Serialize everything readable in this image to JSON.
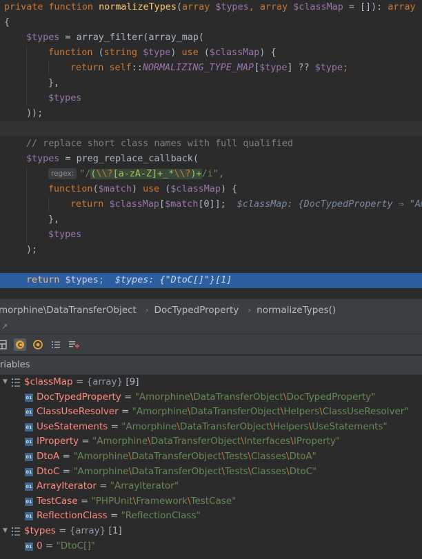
{
  "editor": {
    "signature": {
      "kw_private": "private",
      "kw_function": "function",
      "name": "normalizeTypes",
      "open": "(",
      "t1": "array",
      "p1": "$types",
      "c1": ",",
      "t2": "array",
      "p2": "$classMap",
      "def": " = []): ",
      "ret": "array"
    },
    "brace_open": "{",
    "l3_var": "$types",
    "l3_eq": " = ",
    "l3_fn": "array_filter(array_map(",
    "l4_function": "function",
    "l4_open": " (",
    "l4_string": "string",
    "l4_type": "$type",
    "l4_use_pre": ") ",
    "l4_use": "use",
    "l4_use_open": " (",
    "l4_classmap": "$classMap",
    "l4_close": ") {",
    "l5_return": "return",
    "l5_self": "self",
    "l5_dc": "::",
    "l5_const": "NORMALIZING_TYPE_MAP",
    "l5_br1": "[",
    "l5_type": "$type",
    "l5_br2": "] ?? ",
    "l5_type2": "$type",
    "l5_semi": ";",
    "l6_close": "},",
    "l7_types": "$types",
    "l8_close": "));",
    "l10_comment": "// replace short class names with full qualified",
    "l11_var": "$types",
    "l11_eq": " = ",
    "l11_fn": "preg_replace_callback(",
    "l12_hint": "regex:",
    "l12_q1": "\"/",
    "l12_re1": "(",
    "l12_re2": "\\\\?",
    "l12_re3": "[a-zA-Z]+_*",
    "l12_re4": "\\\\?",
    "l12_re5": ")+",
    "l12_q2": "/i\"",
    "l12_comma": ",",
    "l13_function": "function",
    "l13_open": "(",
    "l13_match": "$match",
    "l13_use_pre": ") ",
    "l13_use": "use",
    "l13_use_open": " (",
    "l13_classmap": "$classMap",
    "l13_close": ") {",
    "l14_return": "return",
    "l14_classmap": "$classMap",
    "l14_br1": "[",
    "l14_match": "$match",
    "l14_br2": "[0]];",
    "l14_inlay": "$classMap: {DocTypedProperty ⇒ \"Amorphine\\DataTransferObject\\DocTypedProperty\"",
    "l15_close": "},",
    "l16_types": "$types",
    "l17_close": ");",
    "l19_return": "return",
    "l19_types": "$types",
    "l19_semi": ";",
    "l19_inlay": "$types: {\"DtoC[]\"}[1]"
  },
  "breadcrumb": {
    "namespace": "morphine\\DataTransferObject",
    "class": "DocTypedProperty",
    "method": "normalizeTypes()"
  },
  "debug": {
    "strip_hint": "↗",
    "variables_header": "riables",
    "classmap": {
      "name": "$classMap",
      "eq": " = ",
      "type": "{array}",
      "count": " [9]",
      "items": [
        {
          "key": "DocTypedProperty",
          "value": "\"Amorphine\\DataTransferObject\\DocTypedProperty\""
        },
        {
          "key": "ClassUseResolver",
          "value": "\"Amorphine\\DataTransferObject\\Helpers\\ClassUseResolver\""
        },
        {
          "key": "UseStatements",
          "value": "\"Amorphine\\DataTransferObject\\Helpers\\UseStatements\""
        },
        {
          "key": "IProperty",
          "value": "\"Amorphine\\DataTransferObject\\Interfaces\\IProperty\""
        },
        {
          "key": "DtoA",
          "value": "\"Amorphine\\DataTransferObject\\Tests\\Classes\\DtoA\""
        },
        {
          "key": "DtoC",
          "value": "\"Amorphine\\DataTransferObject\\Tests\\Classes\\DtoC\""
        },
        {
          "key": "ArrayIterator",
          "value": "\"ArrayIterator\""
        },
        {
          "key": "TestCase",
          "value": "\"PHPUnit\\Framework\\TestCase\""
        },
        {
          "key": "ReflectionClass",
          "value": "\"ReflectionClass\""
        }
      ]
    },
    "types": {
      "name": "$types",
      "eq": " = ",
      "type": "{array}",
      "count": " [1]",
      "items": [
        {
          "key": "0",
          "value": "\"DtoC[]\""
        }
      ]
    },
    "prim_icon_label": "01"
  },
  "colors": {
    "editor_bg": "#2b2b2b",
    "exec_line": "#2d5fa0",
    "keyword": "#cc7832",
    "function": "#ffc66d",
    "variable": "#9876aa",
    "string": "#6a8759",
    "debug_var_name": "#ff8a80"
  },
  "icons": [
    "restore-layout-icon",
    "class-filter-icon",
    "watch-icon",
    "list-icon",
    "add-watch-icon",
    "array-icon",
    "primitive-icon",
    "expand-arrow-icon"
  ]
}
